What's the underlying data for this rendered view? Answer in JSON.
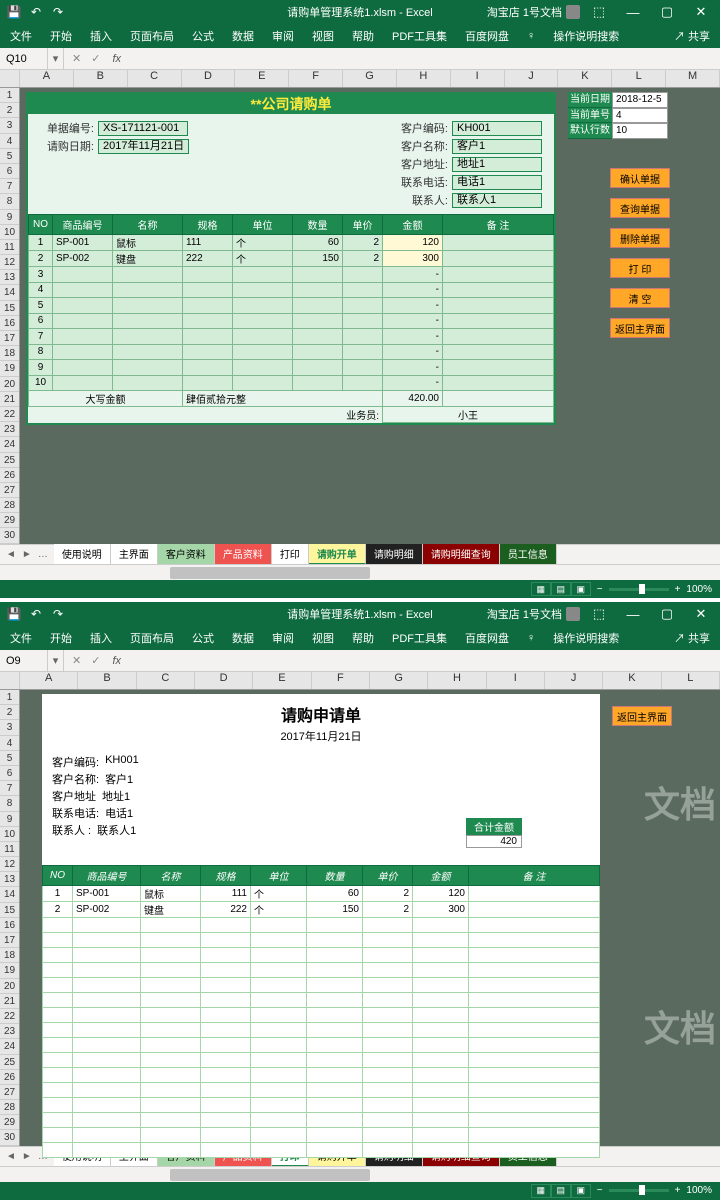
{
  "win1": {
    "qat_save": "💾",
    "title": "请购单管理系统1.xlsm - Excel",
    "account": "淘宝店 1号文档",
    "share": "共享",
    "ribbon": [
      "文件",
      "开始",
      "插入",
      "页面布局",
      "公式",
      "数据",
      "审阅",
      "视图",
      "帮助",
      "PDF工具集",
      "百度网盘"
    ],
    "tell_me": "操作说明搜索",
    "namebox": "Q10",
    "cols": [
      "A",
      "B",
      "C",
      "D",
      "E",
      "F",
      "G",
      "H",
      "I",
      "J",
      "K",
      "L",
      "M"
    ],
    "form": {
      "title": "**公司请购单",
      "l1_label": "单据编号:",
      "l1_val": "XS-171121-001",
      "l2_label": "请购日期:",
      "l2_val": "2017年11月21日",
      "r1_label": "客户编码:",
      "r1_val": "KH001",
      "r2_label": "客户名称:",
      "r2_val": "客户1",
      "r3_label": "客户地址:",
      "r3_val": "地址1",
      "r4_label": "联系电话:",
      "r4_val": "电话1",
      "r5_label": "联系人:",
      "r5_val": "联系人1"
    },
    "headers": [
      "NO",
      "商品编号",
      "名称",
      "规格",
      "单位",
      "数量",
      "单价",
      "金额",
      "备 注"
    ],
    "rows": [
      {
        "no": "1",
        "code": "SP-001",
        "name": "鼠标",
        "spec": "111",
        "unit": "个",
        "qty": "60",
        "price": "2",
        "amt": "120"
      },
      {
        "no": "2",
        "code": "SP-002",
        "name": "键盘",
        "spec": "222",
        "unit": "个",
        "qty": "150",
        "price": "2",
        "amt": "300"
      }
    ],
    "empty_nos": [
      "3",
      "4",
      "5",
      "6",
      "7",
      "8",
      "9",
      "10"
    ],
    "empty_amt": "-",
    "foot_label": "大写金额",
    "foot_cn": "肆佰贰拾元整",
    "foot_amt": "420.00",
    "biz_label": "业务员:",
    "biz_val": "小王",
    "side": [
      {
        "label": "当前日期",
        "val": "2018-12-5"
      },
      {
        "label": "当前单号",
        "val": "4"
      },
      {
        "label": "默认行数",
        "val": "10"
      }
    ],
    "actions": [
      "确认单据",
      "查询单据",
      "删除单据",
      "打    印",
      "清    空",
      "返回主界面"
    ],
    "tabs": [
      {
        "label": "使用说明",
        "cls": ""
      },
      {
        "label": "主界面",
        "cls": ""
      },
      {
        "label": "客户资料",
        "cls": "green"
      },
      {
        "label": "产品资料",
        "cls": "red"
      },
      {
        "label": "打印",
        "cls": ""
      },
      {
        "label": "请购开单",
        "cls": "yellow active"
      },
      {
        "label": "请购明细",
        "cls": "black"
      },
      {
        "label": "请购明细查询",
        "cls": "brown"
      },
      {
        "label": "员工信息",
        "cls": "dgreen"
      }
    ],
    "zoom": "100%"
  },
  "win2": {
    "title": "请购单管理系统1.xlsm - Excel",
    "account": "淘宝店 1号文档",
    "namebox": "O9",
    "cols": [
      "A",
      "B",
      "C",
      "D",
      "E",
      "F",
      "G",
      "H",
      "I",
      "J",
      "K",
      "L"
    ],
    "print": {
      "title": "请购申请单",
      "date": "2017年11月21日",
      "info": [
        [
          "客户编码:",
          "KH001"
        ],
        [
          "客户名称:",
          "客户1"
        ],
        [
          "客户地址",
          "地址1"
        ],
        [
          "联系电话:",
          "电话1"
        ],
        [
          "联系人 :",
          "联系人1"
        ]
      ],
      "total_label": "合计金额",
      "total_val": "420",
      "headers": [
        "NO",
        "商品编号",
        "名称",
        "规格",
        "单位",
        "数量",
        "单价",
        "金额",
        "备 注"
      ],
      "rows": [
        {
          "no": "1",
          "code": "SP-001",
          "name": "鼠标",
          "spec": "111",
          "unit": "个",
          "qty": "60",
          "price": "2",
          "amt": "120"
        },
        {
          "no": "2",
          "code": "SP-002",
          "name": "键盘",
          "spec": "222",
          "unit": "个",
          "qty": "150",
          "price": "2",
          "amt": "300"
        }
      ]
    },
    "return_btn": "返回主界面",
    "tabs": [
      {
        "label": "使用说明",
        "cls": ""
      },
      {
        "label": "主界面",
        "cls": ""
      },
      {
        "label": "客户资料",
        "cls": "green"
      },
      {
        "label": "产品资料",
        "cls": "red"
      },
      {
        "label": "打印",
        "cls": "active"
      },
      {
        "label": "请购开单",
        "cls": "yellow"
      },
      {
        "label": "请购明细",
        "cls": "black"
      },
      {
        "label": "请购明细查询",
        "cls": "brown"
      },
      {
        "label": "员工信息",
        "cls": "dgreen"
      }
    ],
    "watermark": "文档",
    "zoom": "100%"
  },
  "chart_data": {
    "type": "table",
    "title": "**公司请购单",
    "columns": [
      "NO",
      "商品编号",
      "名称",
      "规格",
      "单位",
      "数量",
      "单价",
      "金额"
    ],
    "rows": [
      [
        1,
        "SP-001",
        "鼠标",
        "111",
        "个",
        60,
        2,
        120
      ],
      [
        2,
        "SP-002",
        "键盘",
        "222",
        "个",
        150,
        2,
        300
      ]
    ],
    "total": 420.0
  }
}
